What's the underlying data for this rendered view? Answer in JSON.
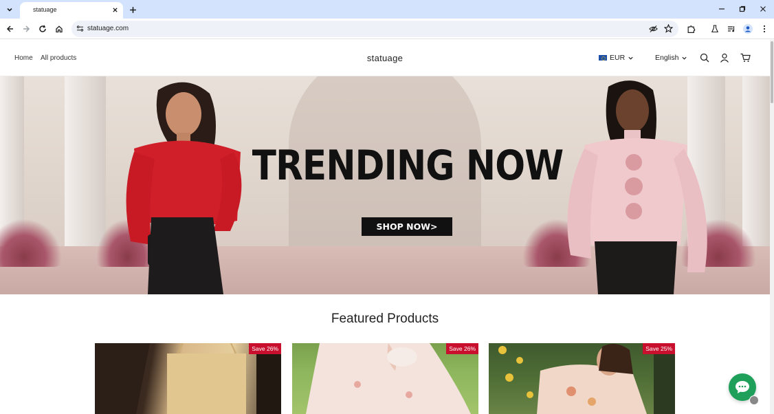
{
  "browser": {
    "tab_title": "statuage",
    "url": "statuage.com"
  },
  "header": {
    "nav": [
      "Home",
      "All products"
    ],
    "brand": "statuage",
    "currency": "EUR",
    "language": "English"
  },
  "hero": {
    "title": "TRENDING NOW",
    "cta": "SHOP NOW>"
  },
  "featured": {
    "title": "Featured Products",
    "products": [
      {
        "badge": "Save 26%"
      },
      {
        "badge": "Save 26%"
      },
      {
        "badge": "Save 25%"
      }
    ]
  },
  "colors": {
    "sale_badge": "#c8102e",
    "chat": "#1fa05a",
    "tabstrip": "#d3e3fd"
  }
}
